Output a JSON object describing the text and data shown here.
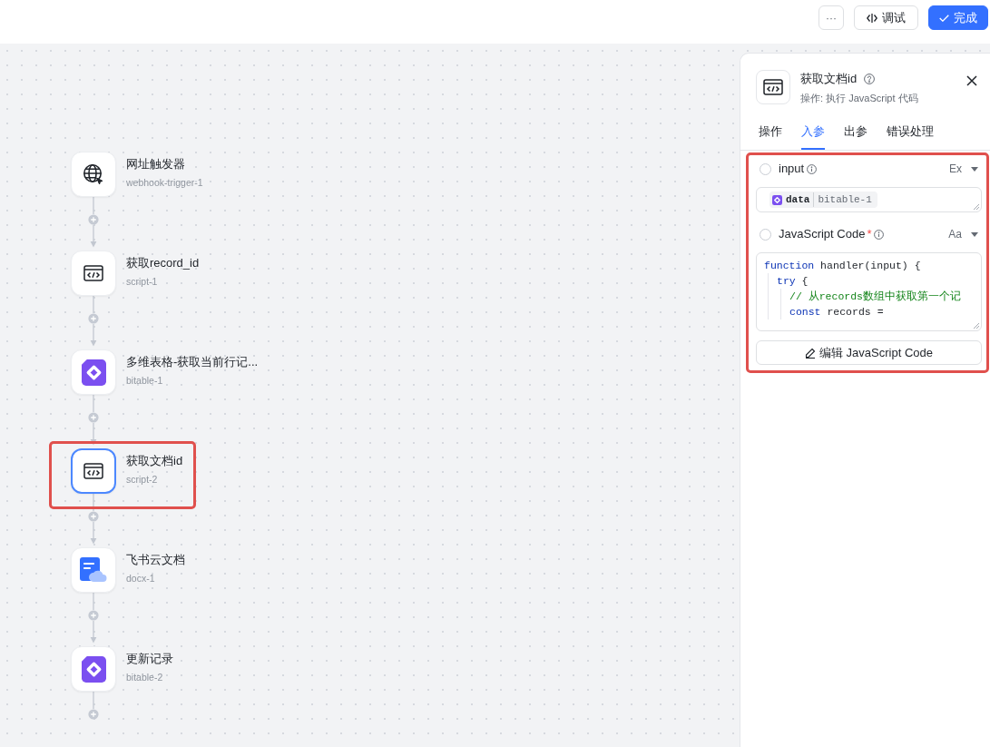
{
  "toolbar": {
    "more_label": "···",
    "buttons": [
      {
        "kind": "debug",
        "label": "调试"
      },
      {
        "kind": "done",
        "label": "完成"
      }
    ]
  },
  "flow": {
    "nodes": [
      {
        "kind": "webhook",
        "title": "网址触发器",
        "subtitle": "webhook-trigger-1",
        "selected": false,
        "highlighted": false
      },
      {
        "kind": "script",
        "title": "获取record_id",
        "subtitle": "script-1",
        "selected": false,
        "highlighted": false
      },
      {
        "kind": "bitable",
        "title": "多维表格-获取当前行记...",
        "subtitle": "bitable-1",
        "selected": false,
        "highlighted": false
      },
      {
        "kind": "script",
        "title": "获取文档id",
        "subtitle": "script-2",
        "selected": true,
        "highlighted": true
      },
      {
        "kind": "docx",
        "title": "飞书云文档",
        "subtitle": "docx-1",
        "selected": false,
        "highlighted": false
      },
      {
        "kind": "bitable",
        "title": "更新记录",
        "subtitle": "bitable-2",
        "selected": false,
        "highlighted": false
      }
    ]
  },
  "panel": {
    "kind": "script",
    "title": "获取文档id",
    "subtitle": "操作: 执行 JavaScript 代码",
    "tabs": [
      {
        "label": "操作",
        "selected": false
      },
      {
        "label": "入参",
        "selected": true
      },
      {
        "label": "出参",
        "selected": false
      },
      {
        "label": "错误处理",
        "selected": false
      }
    ],
    "params_highlighted": true,
    "params": [
      {
        "kind": "reference",
        "name": "input",
        "checked": false,
        "mode": "Ex",
        "value": {
          "field": "data",
          "source": "bitable-1"
        }
      },
      {
        "kind": "code",
        "name": "JavaScript Code",
        "required_mark": "*",
        "checked": false,
        "mode": "Aa",
        "code": [
          {
            "tokens": [
              {
                "kind": "keyword",
                "text": "function"
              },
              {
                "kind": "plain",
                "text": " handler(input) {"
              }
            ],
            "children": [
              {
                "tokens": [
                  {
                    "kind": "keyword",
                    "text": "try"
                  },
                  {
                    "kind": "plain",
                    "text": " {"
                  }
                ],
                "children": [
                  {
                    "tokens": [
                      {
                        "kind": "comment",
                        "text": "// 从records数组中获取第一个记"
                      }
                    ]
                  },
                  {
                    "tokens": [
                      {
                        "kind": "keyword",
                        "text": "const"
                      },
                      {
                        "kind": "plain",
                        "text": " records ="
                      }
                    ]
                  }
                ]
              }
            ]
          }
        ]
      }
    ],
    "edit_button": "编辑 JavaScript Code"
  }
}
